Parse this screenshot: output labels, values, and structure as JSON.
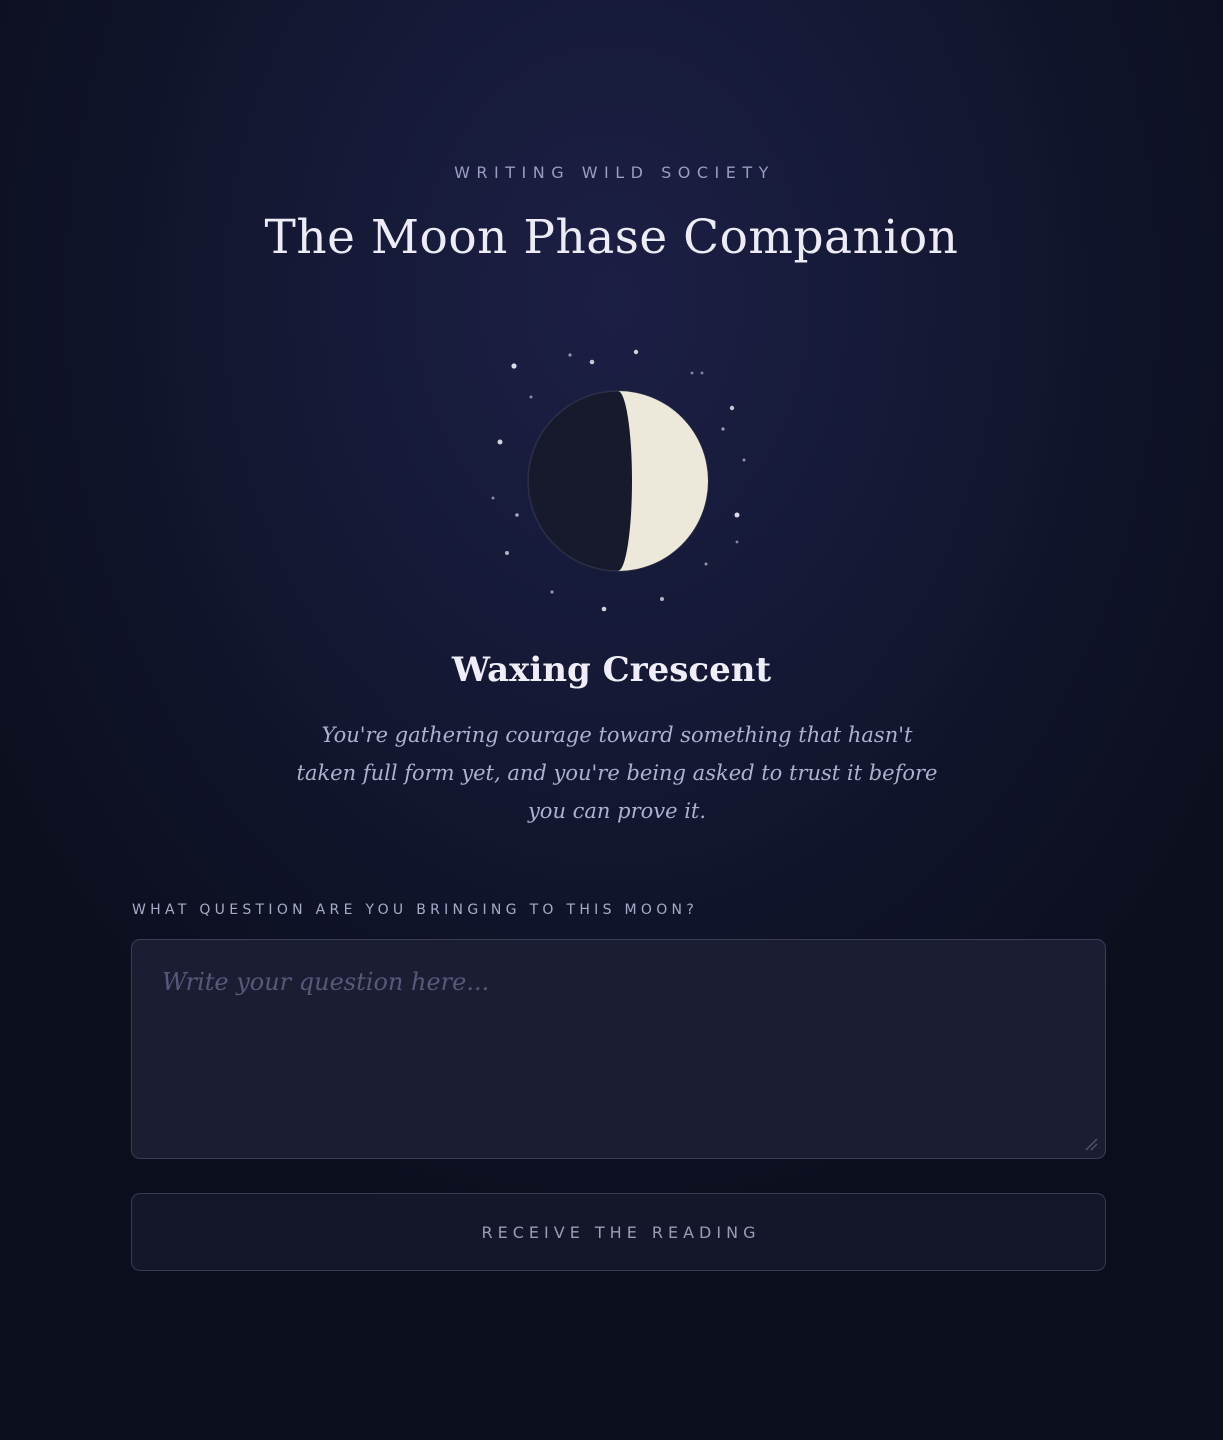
{
  "header": {
    "society": "WRITING WILD SOCIETY",
    "title": "The Moon Phase Companion"
  },
  "moon": {
    "icon": "waxing-crescent-moon-icon",
    "phase_name": "Waxing Crescent",
    "description": "You're gathering courage toward something that hasn't taken full form yet, and you're being asked to trust it before you can prove it.",
    "colors": {
      "lit": "#ece9da",
      "shadow": "#161a2c",
      "stars": "#e6e5f0"
    }
  },
  "question": {
    "label": "WHAT QUESTION ARE YOU BRINGING TO THIS MOON?",
    "value": "",
    "placeholder": "Write your question here..."
  },
  "actions": {
    "receive_label": "RECEIVE THE READING"
  }
}
